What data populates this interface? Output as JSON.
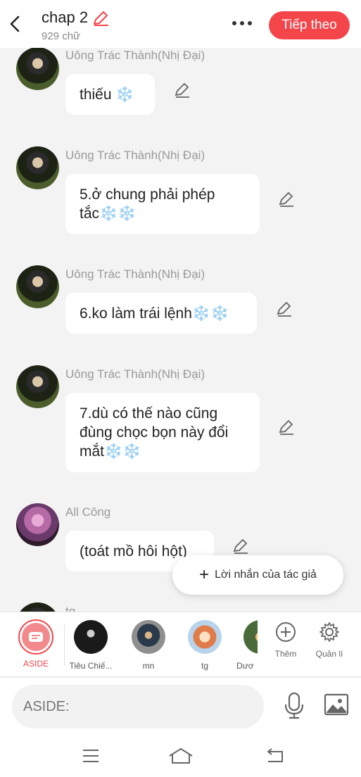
{
  "header": {
    "title": "chap 2",
    "word_count": "929 chữ",
    "next_label": "Tiếp theo"
  },
  "messages": [
    {
      "author": "Uông Trác Thành(Nhị Đại)",
      "text_lines": [
        "thiếu ❄️"
      ]
    },
    {
      "author": "Uông Trác Thành(Nhị Đại)",
      "text_lines": [
        "5.ở chung phải phép",
        "tắc❄️❄️"
      ]
    },
    {
      "author": "Uông Trác Thành(Nhị Đại)",
      "text_lines": [
        "6.ko làm trái lệnh❄️❄️"
      ]
    },
    {
      "author": "Uông Trác Thành(Nhị Đại)",
      "text_lines": [
        "7.dù có thế nào cũng",
        "đùng chọc bọn này đổi",
        "mắt❄️❄️"
      ]
    },
    {
      "author": "All Công",
      "text_lines": [
        "(toát mồ hôi hột)"
      ]
    },
    {
      "author": "tg"
    }
  ],
  "float_button": {
    "label": "Lời nhắn của tác giả"
  },
  "characters": [
    {
      "label": "ASIDE"
    },
    {
      "label": "Tiêu Chiế..."
    },
    {
      "label": "mn"
    },
    {
      "label": "tg"
    },
    {
      "label": "Dươ"
    }
  ],
  "tools": {
    "more_label": "Thêm",
    "manage_label": "Quản lí"
  },
  "input": {
    "placeholder": "ASIDE:"
  },
  "colors": {
    "accent": "#f4454b",
    "aside_fill": "#f28a8d"
  }
}
